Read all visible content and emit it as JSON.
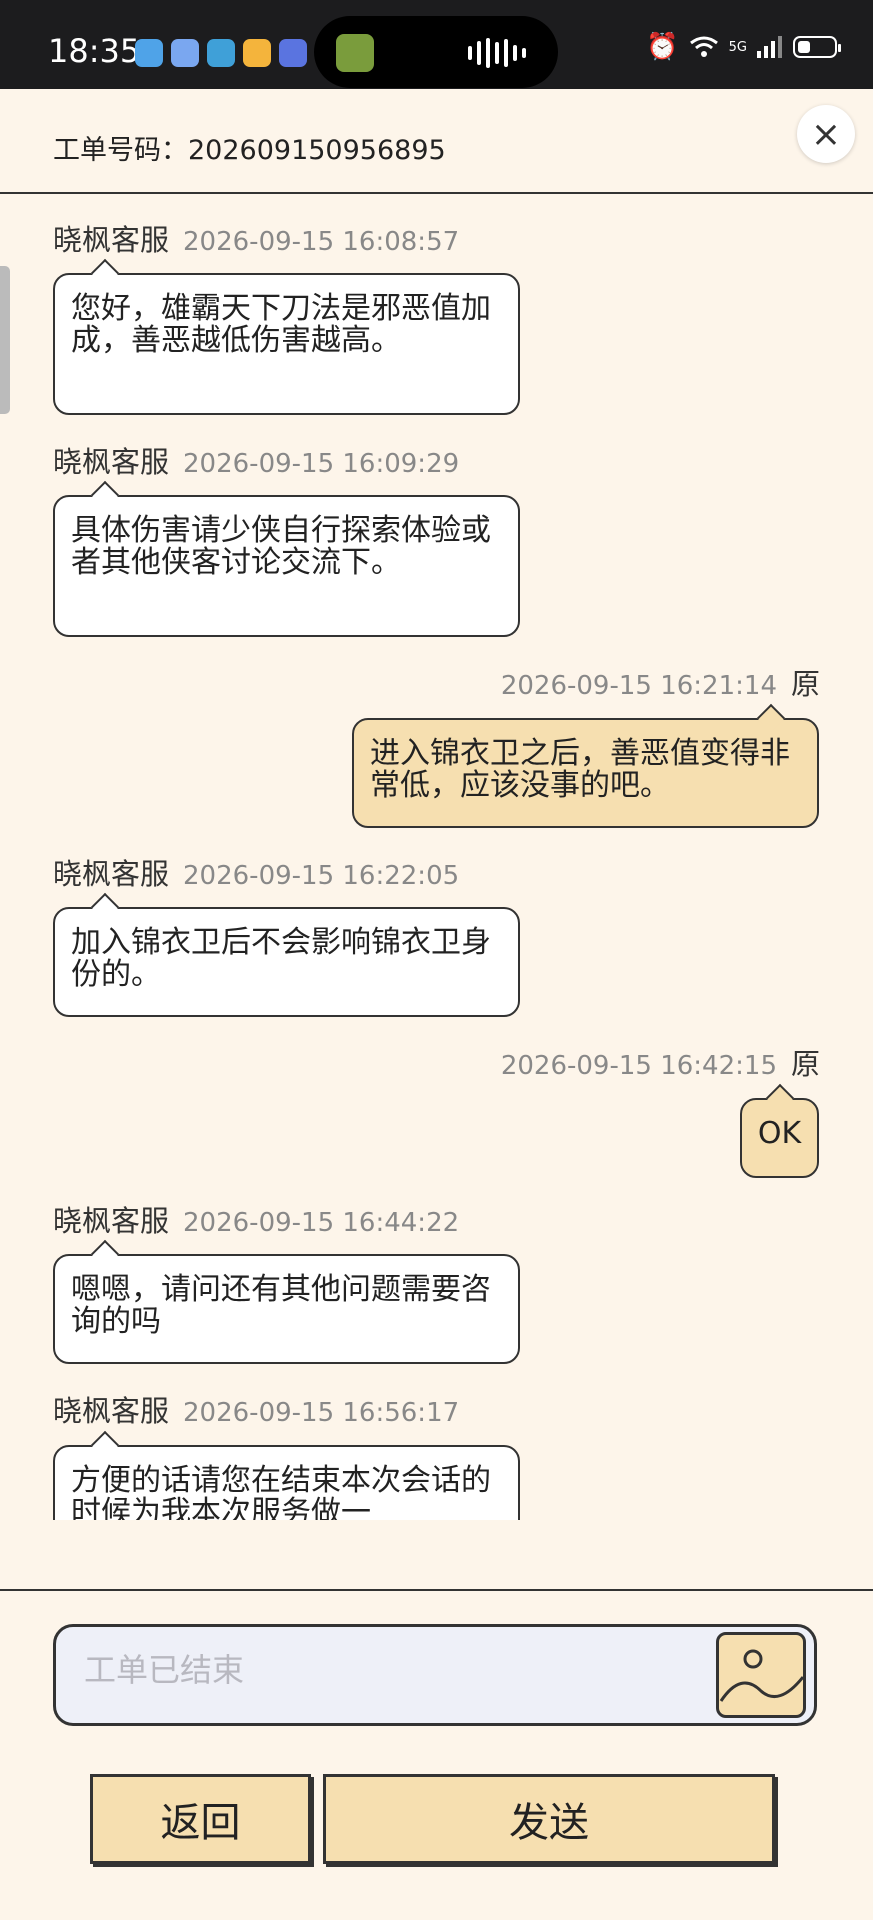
{
  "status_bar": {
    "time": "18:35",
    "app_icon_colors": [
      "#4fa3e8",
      "#7aa7f0",
      "#3fa0d8",
      "#f4b43c",
      "#5a74e0"
    ],
    "network": "5G",
    "battery_level": 0.35
  },
  "header": {
    "ticket_label": "工单号码：202609150956895",
    "close_icon": "×"
  },
  "messages": [
    {
      "from": "agent",
      "sender": "晓枫客服",
      "time": "2026-09-15 16:08:57",
      "text": "您好，雄霸天下刀法是邪恶值加成，善恶越低伤害越高。"
    },
    {
      "from": "agent",
      "sender": "晓枫客服",
      "time": "2026-09-15 16:09:29",
      "text": "具体伤害请少侠自行探索体验或者其他侠客讨论交流下。"
    },
    {
      "from": "user",
      "sender": "原",
      "time": "2026-09-15 16:21:14",
      "text": "进入锦衣卫之后，善恶值变得非常低，应该没事的吧。"
    },
    {
      "from": "agent",
      "sender": "晓枫客服",
      "time": "2026-09-15 16:22:05",
      "text": "加入锦衣卫后不会影响锦衣卫身份的。"
    },
    {
      "from": "user",
      "sender": "原",
      "time": "2026-09-15 16:42:15",
      "text": "OK"
    },
    {
      "from": "agent",
      "sender": "晓枫客服",
      "time": "2026-09-15 16:44:22",
      "text": "嗯嗯，请问还有其他问题需要咨询的吗"
    },
    {
      "from": "agent",
      "sender": "晓枫客服",
      "time": "2026-09-15 16:56:17",
      "text": "方便的话请您在结束本次会话的时候为我本次服务做一"
    }
  ],
  "input": {
    "placeholder": "工单已结束",
    "image_button_icon": "image-icon"
  },
  "buttons": {
    "back": "返回",
    "send": "发送"
  },
  "colors": {
    "background": "#fdf5ea",
    "user_bubble": "#f6dfb0",
    "agent_bubble": "#ffffff",
    "border": "#333333"
  }
}
